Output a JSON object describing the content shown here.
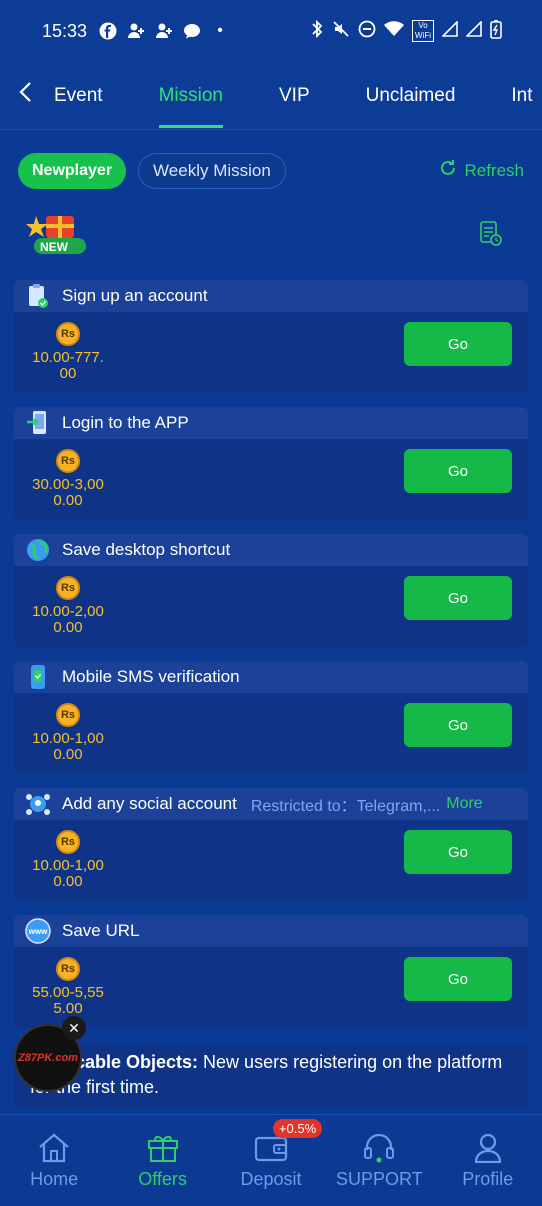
{
  "status_bar": {
    "time": "15:33",
    "volte_label": "Vo WiFi"
  },
  "tabs": [
    {
      "label": "Event"
    },
    {
      "label": "Mission"
    },
    {
      "label": "VIP"
    },
    {
      "label": "Unclaimed"
    },
    {
      "label": "Int"
    }
  ],
  "filters": {
    "active": "Newplayer",
    "other": "Weekly Mission",
    "refresh": "Refresh"
  },
  "new_badge_text": "NEW",
  "missions": [
    {
      "title": "Sign up an account",
      "amount": "10.00-777.00",
      "button": "Go",
      "icon": "clipboard-check-icon"
    },
    {
      "title": "Login to the APP",
      "amount": "30.00-3,000.00",
      "button": "Go",
      "icon": "phone-login-icon"
    },
    {
      "title": "Save desktop shortcut",
      "amount": "10.00-2,000.00",
      "button": "Go",
      "icon": "globe-icon"
    },
    {
      "title": "Mobile SMS verification",
      "amount": "10.00-1,000.00",
      "button": "Go",
      "icon": "mobile-sms-icon"
    },
    {
      "title": "Add any social account",
      "amount": "10.00-1,000.00",
      "button": "Go",
      "icon": "social-icon",
      "restricted": "Restricted to：Telegram,...",
      "more": "More"
    },
    {
      "title": "Save URL",
      "amount": "55.00-5,555.00",
      "button": "Go",
      "icon": "www-icon"
    }
  ],
  "currency_symbol": "Rs",
  "applicable": {
    "label": "Applicable Objects:",
    "text": " New users registering on the platform for the first time."
  },
  "floating_ad": {
    "text": "Z87PK.com"
  },
  "bottom_nav": [
    {
      "label": "Home",
      "icon": "home-icon"
    },
    {
      "label": "Offers",
      "icon": "gift-icon"
    },
    {
      "label": "Deposit",
      "icon": "wallet-icon",
      "badge": "+0.5%"
    },
    {
      "label": "SUPPORT",
      "icon": "headset-icon"
    },
    {
      "label": "Profile",
      "icon": "profile-icon"
    }
  ]
}
